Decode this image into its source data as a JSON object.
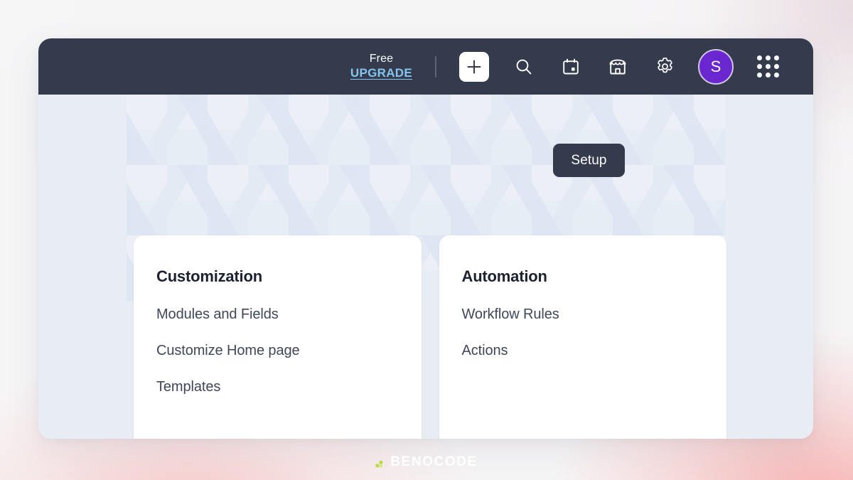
{
  "window": {
    "topbar": {
      "plan_label": "Free",
      "upgrade_label": "UPGRADE",
      "icons": [
        {
          "name": "add-icon",
          "label": "Add"
        },
        {
          "name": "search-icon",
          "label": "Search"
        },
        {
          "name": "calendar-icon",
          "label": "Calendar"
        },
        {
          "name": "marketplace-icon",
          "label": "Marketplace"
        },
        {
          "name": "gear-icon",
          "label": "Setup"
        }
      ],
      "avatar_initial": "S",
      "apps_grid_label": "Apps",
      "colors": {
        "bar_background": "#343b4d",
        "upgrade_link": "#86c5f0",
        "avatar_background": "#6b27cf"
      }
    },
    "tooltip": {
      "label": "Setup"
    },
    "cards": [
      {
        "title": "Customization",
        "links": [
          "Modules and Fields",
          "Customize Home page",
          "Templates"
        ]
      },
      {
        "title": "Automation",
        "links": [
          "Workflow Rules",
          "Actions"
        ]
      }
    ]
  },
  "footer": {
    "brand": "BENOCODE",
    "accent_color": "#b9d93c"
  }
}
